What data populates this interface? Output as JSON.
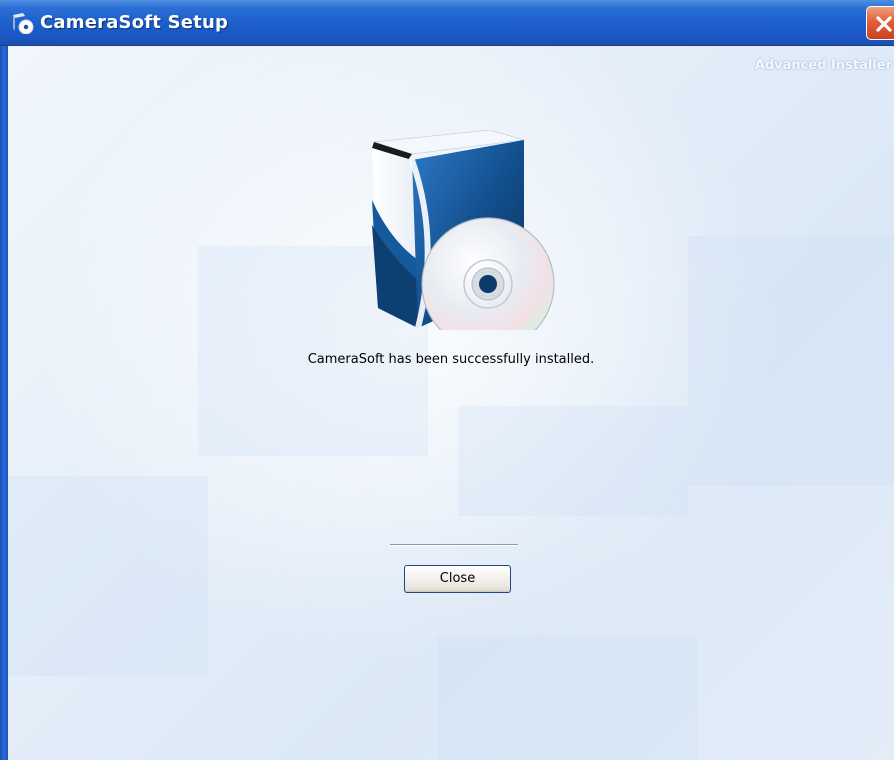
{
  "window": {
    "title": "CameraSoft Setup",
    "icons": {
      "app": "setup-app-icon",
      "close": "close-icon"
    },
    "colors": {
      "titlebar": "#1d5fcc",
      "close_button": "#e0603a"
    }
  },
  "header": {
    "brand": "Advanced Installer"
  },
  "content": {
    "graphic": "software-box-cd-icon",
    "message": "CameraSoft has been successfully installed."
  },
  "footer": {
    "close_label": "Close"
  }
}
